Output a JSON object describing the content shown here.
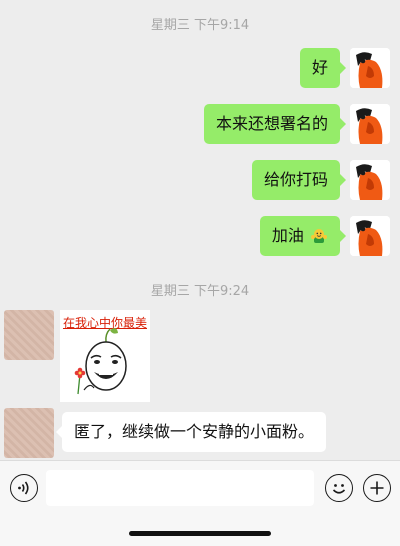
{
  "chat": {
    "timestamps": [
      "星期三 下午9:14",
      "星期三 下午9:24"
    ],
    "outgoing": [
      {
        "text": "好"
      },
      {
        "text": "本来还想署名的"
      },
      {
        "text": "给你打码"
      },
      {
        "text": "加油",
        "emoji": "cheer-emoji"
      }
    ],
    "incoming": [
      {
        "type": "sticker",
        "caption": "在我心中你最美",
        "icon": "meme-face-sticker"
      },
      {
        "type": "text",
        "text": "匿了，继续做一个安静的小面粉。"
      }
    ]
  },
  "inputbar": {
    "voice_icon": "voice-icon",
    "emoji_icon": "emoji-icon",
    "add_icon": "add-icon",
    "input_value": ""
  },
  "colors": {
    "background": "#ededed",
    "outgoing_bubble": "#95ec69",
    "incoming_bubble": "#ffffff",
    "timestamp_text": "#a6a6a6",
    "sticker_caption": "#d81e06"
  }
}
